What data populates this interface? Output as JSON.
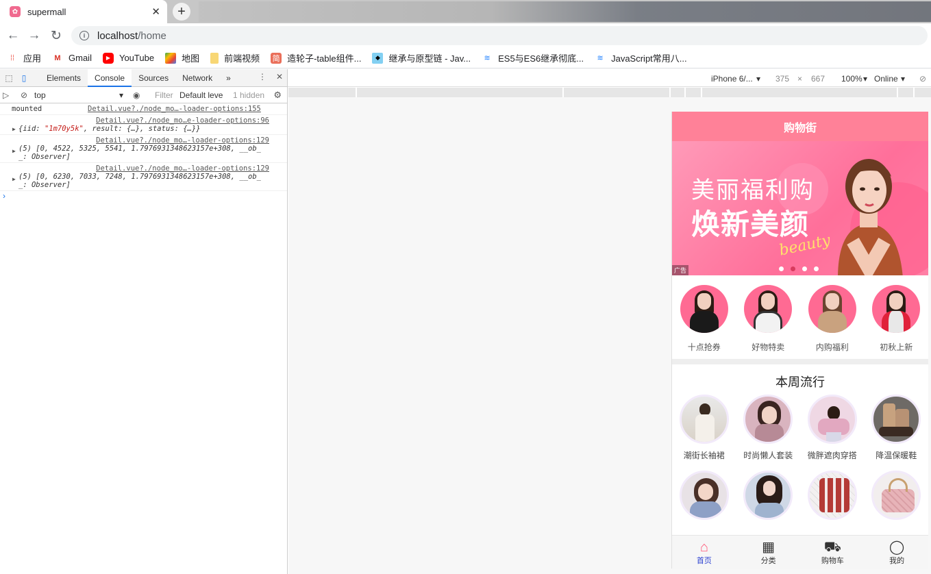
{
  "browser": {
    "tab_title": "supermall",
    "url_host": "localhost",
    "url_path": "/home",
    "bookmarks": [
      "应用",
      "Gmail",
      "YouTube",
      "地图",
      "前端视频",
      "造轮子-table组件...",
      "继承与原型链 - Jav...",
      "ES5与ES6继承彻底...",
      "JavaScript常用八..."
    ]
  },
  "devtools": {
    "tabs": [
      "Elements",
      "Console",
      "Sources",
      "Network"
    ],
    "active_tab": "Console",
    "context": "top",
    "filter_placeholder": "Filter",
    "level": "Default leve",
    "hidden": "1 hidden",
    "logs": [
      {
        "src": "",
        "text": "mounted",
        "src_right": "Detail.vue?./node_mo…-loader-options:155"
      },
      {
        "src": "Detail.vue?./node_mo…e-loader-options:96",
        "prefix": "{iid: ",
        "str": "\"1m70y5k\"",
        "rest": ", result: {…}, status: {…}}"
      },
      {
        "src": "Detail.vue?./node_mo…-loader-options:129",
        "line1": "(5) [0, 4522, 5325, 5541, 1.7976931348623157e+308, __ob_",
        "line2": "_: Observer]"
      },
      {
        "src": "Detail.vue?./node_mo…-loader-options:129",
        "line1": "(5) [0, 6230, 7033, 7248, 1.7976931348623157e+308, __ob_",
        "line2": "_: Observer]"
      }
    ]
  },
  "device_bar": {
    "device": "iPhone 6/...",
    "width": "375",
    "x": "×",
    "height": "667",
    "zoom": "100%",
    "network": "Online"
  },
  "app": {
    "nav_title": "购物街",
    "banner": {
      "line1": "美丽福利购",
      "line2": "焕新美颜",
      "script": "beauty",
      "ad": "广告"
    },
    "recommends": [
      "十点抢券",
      "好物特卖",
      "内购福利",
      "初秋上新"
    ],
    "weekly_title": "本周流行",
    "weekly_items": [
      "潮街长袖裙",
      "时尚懒人套装",
      "微胖遮肉穿搭",
      "降温保暖鞋",
      "",
      "",
      "",
      ""
    ],
    "tabbar": [
      "首页",
      "分类",
      "购物车",
      "我的"
    ],
    "colors": {
      "nav": "#ff8198",
      "active": "#ff5777"
    }
  }
}
